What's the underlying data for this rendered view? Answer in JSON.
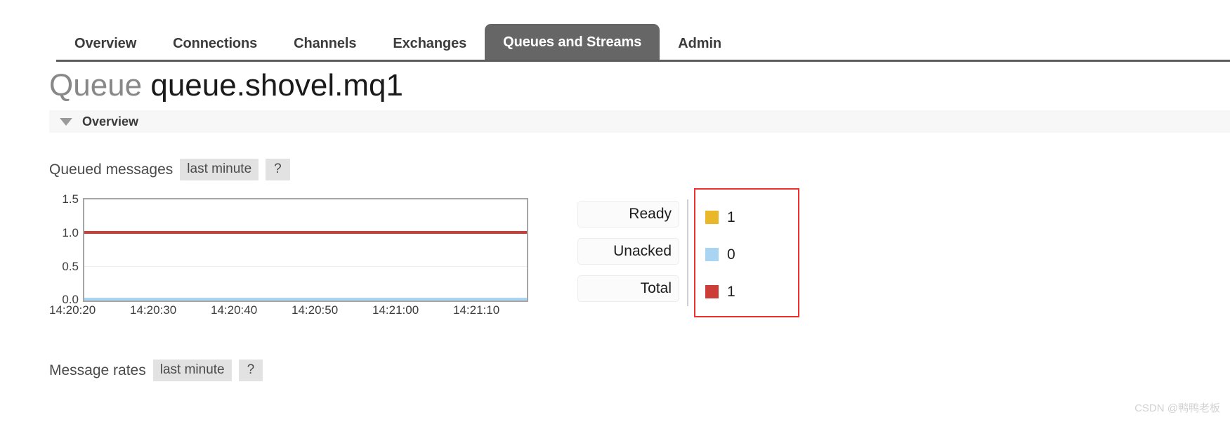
{
  "nav": {
    "tabs": [
      {
        "label": "Overview",
        "active": false
      },
      {
        "label": "Connections",
        "active": false
      },
      {
        "label": "Channels",
        "active": false
      },
      {
        "label": "Exchanges",
        "active": false
      },
      {
        "label": "Queues and Streams",
        "active": true
      },
      {
        "label": "Admin",
        "active": false
      }
    ]
  },
  "page": {
    "title_kind": "Queue",
    "title_name": "queue.shovel.mq1"
  },
  "section": {
    "overview_label": "Overview",
    "caret_icon": "triangle-down-icon"
  },
  "queued_messages": {
    "title": "Queued messages",
    "range_label": "last minute",
    "help_label": "?"
  },
  "message_rates": {
    "title": "Message rates",
    "range_label": "last minute",
    "help_label": "?"
  },
  "stats": {
    "rows": [
      {
        "label": "Ready",
        "value": "1",
        "color": "#e8b72a"
      },
      {
        "label": "Unacked",
        "value": "0",
        "color": "#a9d5f2"
      },
      {
        "label": "Total",
        "value": "1",
        "color": "#cc3d38"
      }
    ]
  },
  "watermark": {
    "text": "CSDN @鸭鸭老板"
  },
  "chart_data": {
    "type": "line",
    "title": "Queued messages",
    "xlabel": "",
    "ylabel": "",
    "ylim": [
      0.0,
      1.5
    ],
    "yticks": [
      0.0,
      0.5,
      1.0,
      1.5
    ],
    "ytick_labels": [
      "0.0",
      "0.5",
      "1.0",
      "1.5"
    ],
    "x": [
      "14:20:20",
      "14:20:30",
      "14:20:40",
      "14:20:50",
      "14:21:00",
      "14:21:10"
    ],
    "xtick_labels": [
      "14:20:20",
      "14:20:30",
      "14:20:40",
      "14:20:50",
      "14:21:00",
      "14:21:10"
    ],
    "grid": true,
    "legend_position": "right",
    "series": [
      {
        "name": "Total",
        "color": "#cc3d38",
        "values": [
          1,
          1,
          1,
          1,
          1,
          1
        ]
      },
      {
        "name": "Ready",
        "color": "#e8b72a",
        "values": [
          1,
          1,
          1,
          1,
          1,
          1
        ]
      },
      {
        "name": "Unacked",
        "color": "#a9d5f2",
        "values": [
          0,
          0,
          0,
          0,
          0,
          0
        ]
      }
    ]
  }
}
